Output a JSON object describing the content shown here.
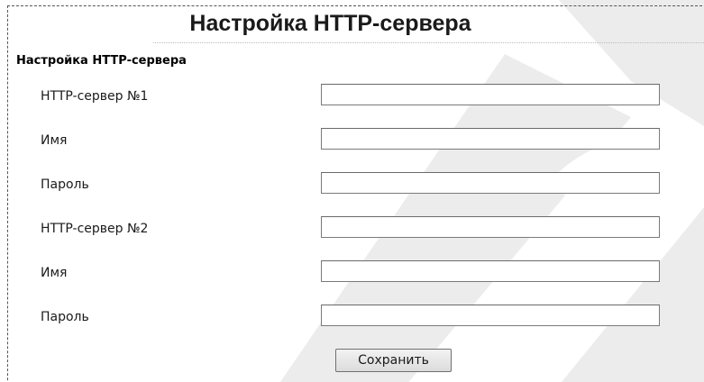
{
  "page": {
    "title": "Настройка HTTP-сервера",
    "section_title": "Настройка HTTP-сервера"
  },
  "form": {
    "fields": [
      {
        "label": "HTTP-сервер №1",
        "value": ""
      },
      {
        "label": "Имя",
        "value": ""
      },
      {
        "label": "Пароль",
        "value": ""
      },
      {
        "label": "HTTP-сервер №2",
        "value": ""
      },
      {
        "label": "Имя",
        "value": ""
      },
      {
        "label": "Пароль",
        "value": ""
      }
    ],
    "save_label": "Сохранить"
  },
  "colors": {
    "watermark": "#ececec",
    "input_border": "#7a7a7a",
    "frame_border": "#555555"
  }
}
